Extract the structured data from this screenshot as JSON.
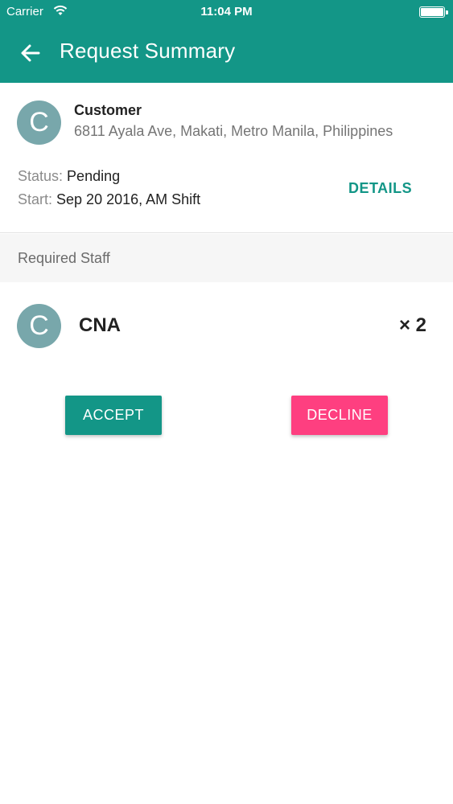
{
  "status_bar": {
    "carrier": "Carrier",
    "time": "11:04 PM",
    "wifi_icon": "wifi-icon",
    "battery_icon": "battery-icon"
  },
  "appbar": {
    "title": "Request Summary",
    "back_icon": "arrow-left-icon",
    "color": "#139687"
  },
  "customer": {
    "avatar_letter": "C",
    "name": "Customer",
    "address": "6811 Ayala Ave, Makati, Metro Manila, Philippines",
    "status_label": "Status:",
    "status_value": "Pending",
    "start_label": "Start:",
    "start_value": "Sep 20 2016, AM Shift",
    "details_label": "DETAILS"
  },
  "required_staff": {
    "header": "Required Staff",
    "items": [
      {
        "avatar_letter": "C",
        "role": "CNA",
        "count": "× 2"
      }
    ]
  },
  "actions": {
    "accept_label": "ACCEPT",
    "decline_label": "DECLINE",
    "accept_color": "#139687",
    "decline_color": "#fe3f80"
  }
}
